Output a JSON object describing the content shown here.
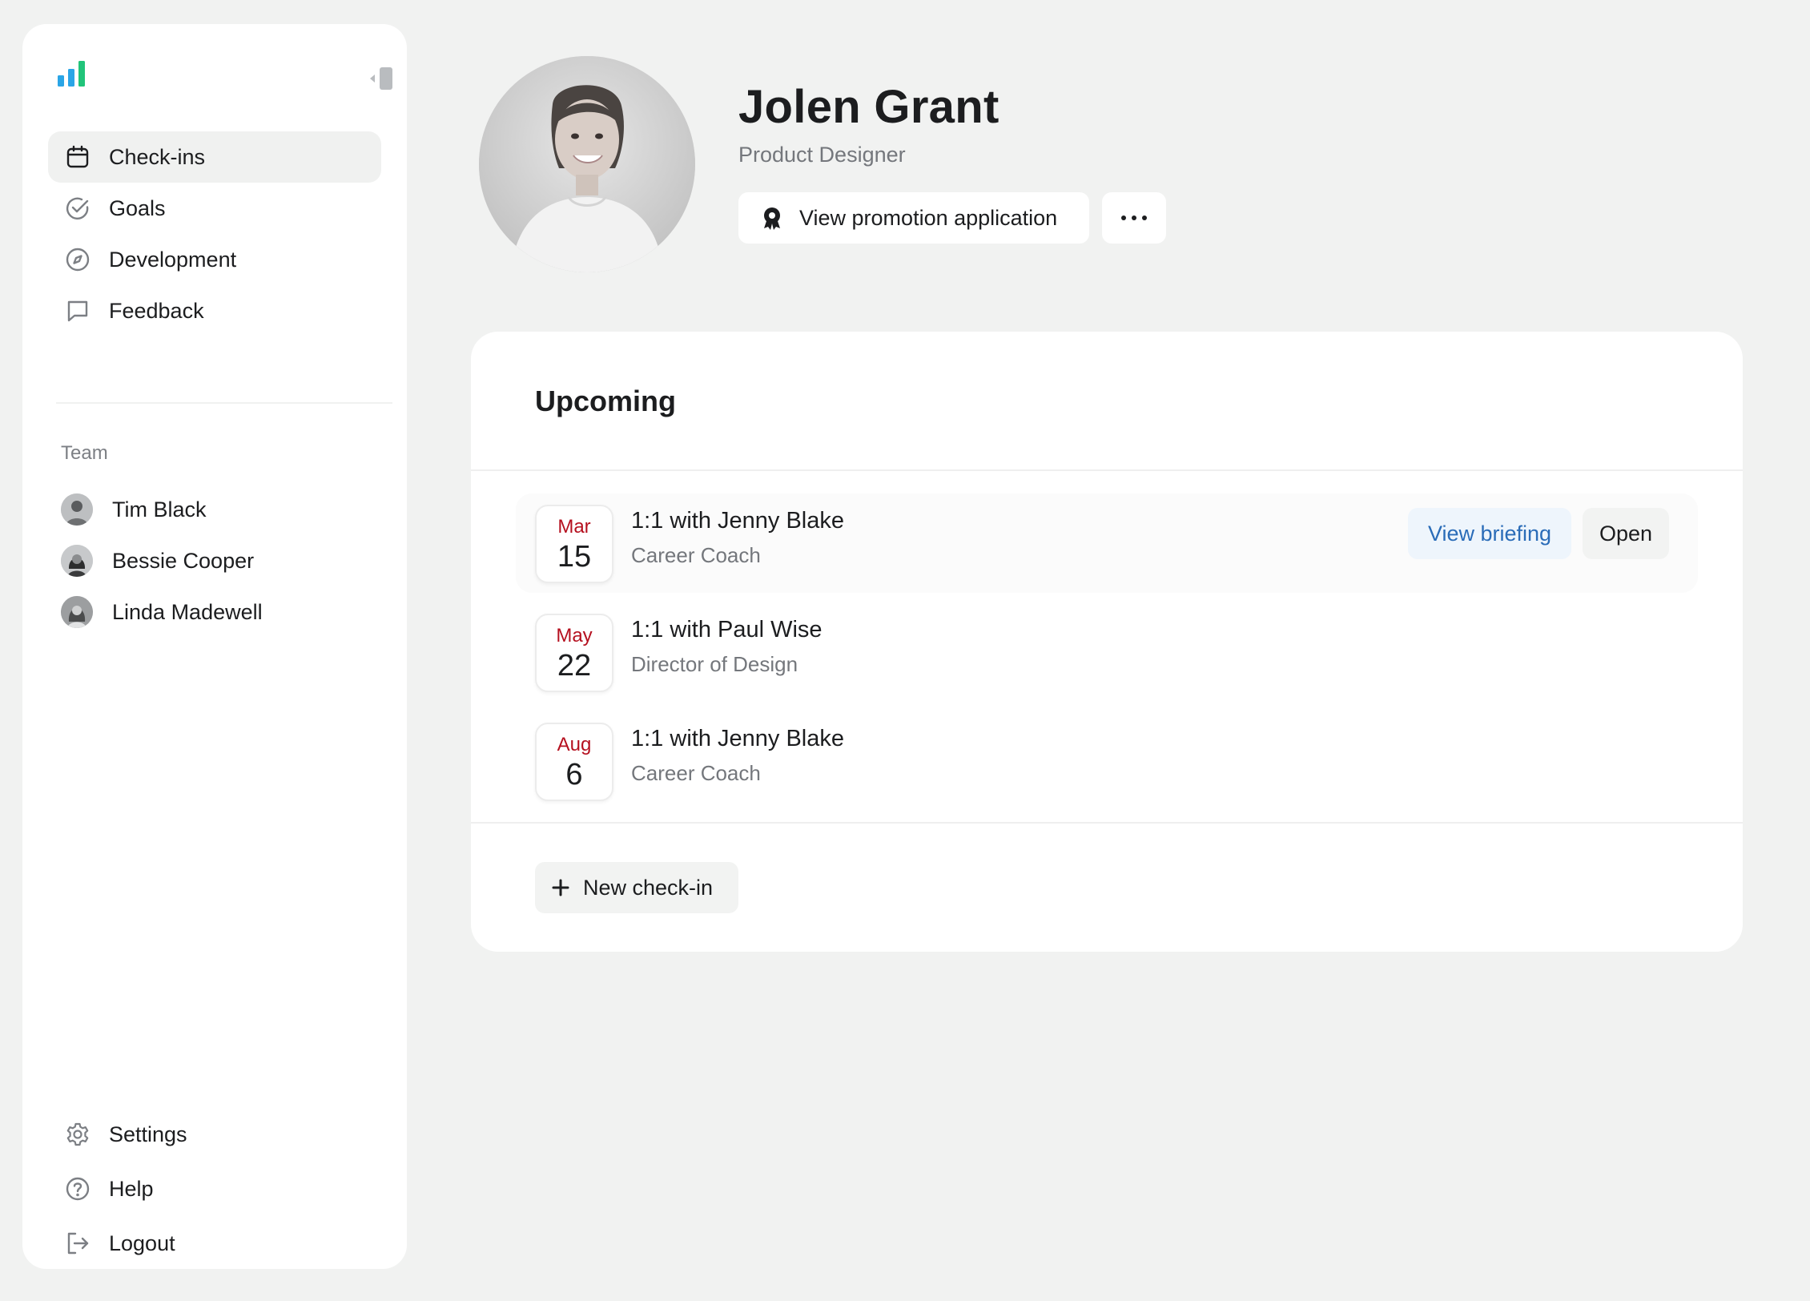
{
  "colors": {
    "accent_blue": "#2a6cb8",
    "date_red": "#b5101f",
    "logo_blue": "#2aa5e6",
    "logo_green": "#21c47a"
  },
  "sidebar": {
    "items": [
      {
        "label": "Check-ins",
        "icon": "calendar-icon",
        "active": true
      },
      {
        "label": "Goals",
        "icon": "check-circle-icon",
        "active": false
      },
      {
        "label": "Development",
        "icon": "compass-icon",
        "active": false
      },
      {
        "label": "Feedback",
        "icon": "chat-bubble-icon",
        "active": false
      }
    ],
    "team_label": "Team",
    "team": [
      {
        "name": "Tim Black"
      },
      {
        "name": "Bessie Cooper"
      },
      {
        "name": "Linda Madewell"
      }
    ],
    "bottom": [
      {
        "label": "Settings",
        "icon": "gear-icon"
      },
      {
        "label": "Help",
        "icon": "help-icon"
      },
      {
        "label": "Logout",
        "icon": "logout-icon"
      }
    ]
  },
  "profile": {
    "name": "Jolen Grant",
    "role": "Product Designer",
    "promo_button": "View promotion application"
  },
  "upcoming": {
    "title": "Upcoming",
    "items": [
      {
        "month": "Mar",
        "day": "15",
        "title": "1:1 with Jenny Blake",
        "subtitle": "Career Coach"
      },
      {
        "month": "May",
        "day": "22",
        "title": "1:1 with Paul Wise",
        "subtitle": "Director of Design"
      },
      {
        "month": "Aug",
        "day": "6",
        "title": "1:1 with Jenny Blake",
        "subtitle": "Career Coach"
      }
    ],
    "view_briefing": "View briefing",
    "open": "Open",
    "new_checkin": "New check-in"
  }
}
